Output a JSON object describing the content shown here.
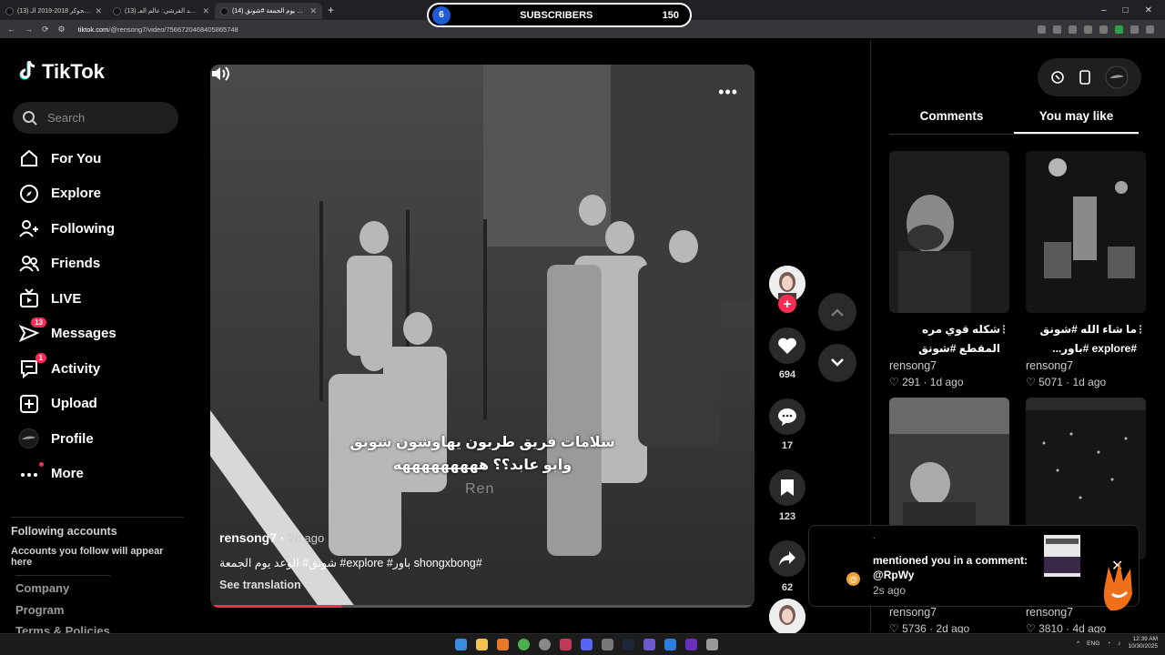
{
  "browser": {
    "tabs": [
      {
        "title": "(13) فيديو الجوكر 2018-2019 الـ...",
        "close": "✕"
      },
      {
        "title": "(13) عبد الصمد القرشي: عالم العـ...",
        "close": "✕"
      },
      {
        "title": "(14) الوعد يوم الجمعة #شونق",
        "close": "✕"
      }
    ],
    "new_tab": "+",
    "url_host": "tiktok.com",
    "url_path": "/@rensong7/video/7566720468405865748"
  },
  "overlay": {
    "counter": "6",
    "label": "SUBSCRIBERS",
    "target": "150"
  },
  "sidebar": {
    "logo": "TikTok",
    "search_placeholder": "Search",
    "nav": [
      {
        "label": "For You",
        "icon": "home-icon"
      },
      {
        "label": "Explore",
        "icon": "compass-icon"
      },
      {
        "label": "Following",
        "icon": "following-icon"
      },
      {
        "label": "Friends",
        "icon": "friends-icon"
      },
      {
        "label": "LIVE",
        "icon": "live-icon"
      },
      {
        "label": "Messages",
        "icon": "messages-icon",
        "badge": "13"
      },
      {
        "label": "Activity",
        "icon": "activity-icon",
        "badge": "1"
      },
      {
        "label": "Upload",
        "icon": "upload-icon"
      },
      {
        "label": "Profile",
        "icon": "profile-avatar"
      },
      {
        "label": "More",
        "icon": "more-icon"
      }
    ],
    "following_accounts_title": "Following accounts",
    "following_accounts_text": "Accounts you follow will appear here",
    "footer": [
      "Company",
      "Program",
      "Terms & Policies"
    ]
  },
  "video": {
    "caption_line1": "سلامات فريق طربون يهاوشون شونق",
    "caption_line2": "وابو عابد؟؟ هههههههههه",
    "watermark": "Ren",
    "author": "rensong7",
    "time": "2h ago",
    "description": "#shongxbong باور# explore# شونق# الوعد يوم الجمعة",
    "see_translation": "See translation",
    "progress": 0.24
  },
  "actions": {
    "likes": "694",
    "comments": "17",
    "saves": "123",
    "shares": "62"
  },
  "panel": {
    "tabs": [
      "Comments",
      "You may like"
    ],
    "active_tab": 1,
    "cards": [
      {
        "title": "شكله قوي مره المقطع #شونق #explore...",
        "user": "rensong7",
        "likes": "291",
        "age": "1d ago"
      },
      {
        "title": "ما شاء الله #شونق #explore #باور...",
        "user": "rensong7",
        "likes": "5071",
        "age": "1d ago"
      },
      {
        "title": "",
        "user": "rensong7",
        "likes": "5736",
        "age": "2d ago"
      },
      {
        "title": "",
        "user": "rensong7",
        "likes": "3810",
        "age": "4d ago"
      }
    ]
  },
  "notification": {
    "dot": ".",
    "text": "mentioned you in a comment: @RpWy",
    "time": "2s ago"
  },
  "taskbar": {
    "lang": "ENG",
    "time": "12:39 AM",
    "date": "10/30/2025"
  },
  "colors": {
    "accent": "#fe2c55",
    "overlay_blue": "#1f5bd6"
  }
}
